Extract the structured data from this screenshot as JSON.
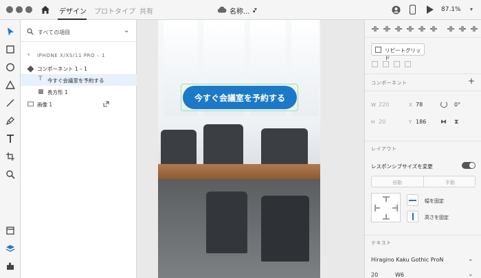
{
  "header": {
    "tabs": [
      {
        "label": "デザイン",
        "active": true
      },
      {
        "label": "プロトタイプ",
        "active": false
      },
      {
        "label": "共有",
        "active": false
      }
    ],
    "doc_title": "名称... •",
    "zoom": "87.1%"
  },
  "toolbar": {
    "tools": [
      "select-tool",
      "rectangle-tool",
      "ellipse-tool",
      "polygon-tool",
      "line-tool",
      "pen-tool",
      "text-tool",
      "artboard-tool",
      "zoom-tool"
    ],
    "bottom": [
      "assets-panel",
      "layers-panel",
      "plugins-panel"
    ],
    "active_tool": "select-tool"
  },
  "layers": {
    "search_label": "すべての項目",
    "artboard": "IPHONE X/XS/11 PRO – 1",
    "items": [
      {
        "label": "コンポーネント 1 – 1",
        "icon": "component-icon"
      },
      {
        "label": "今すぐ会議室を予約する",
        "icon": "text-icon",
        "selected": true
      },
      {
        "label": "長方形 1",
        "icon": "rectangle-icon"
      },
      {
        "label": "画像 1",
        "icon": "image-icon"
      }
    ]
  },
  "canvas": {
    "cta_label": "今すぐ会議室を予約する",
    "cta_color": "#1c79c7"
  },
  "inspector": {
    "repeat_grid": "リピートグリッド",
    "component_title": "コンポーネント",
    "w_label": "W",
    "w_value": "220",
    "h_label": "H",
    "h_value": "20",
    "x_label": "X",
    "x_value": "78",
    "y_label": "Y",
    "y_value": "186",
    "rotation": "0°",
    "layout_title": "レイアウト",
    "responsive_label": "レスポンシブサイズを変更",
    "responsive_on": true,
    "seg_auto": "自動",
    "seg_manual": "手動",
    "fix_width": "幅を固定",
    "fix_height": "高さを固定",
    "text_title": "テキスト",
    "font_family": "Hiragino Kaku Gothic ProN",
    "font_size": "20",
    "font_weight": "W6"
  }
}
